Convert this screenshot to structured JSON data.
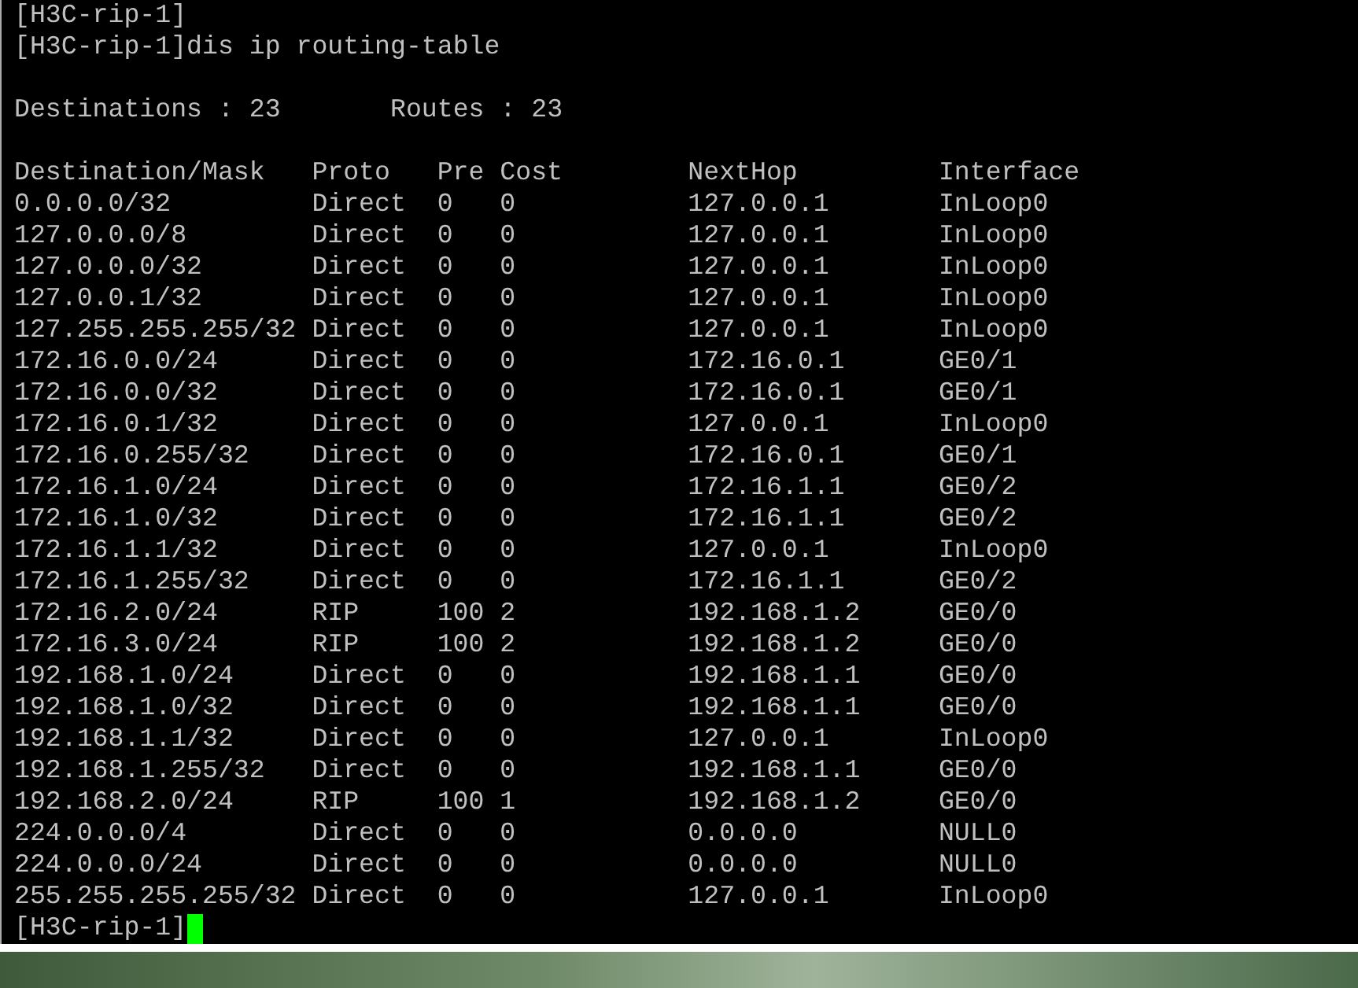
{
  "terminal": {
    "lines_before": [
      "[H3C-rip-1]",
      "[H3C-rip-1]dis ip routing-table"
    ],
    "summary": {
      "destinations": "Destinations : 23",
      "routes": "Routes : 23"
    },
    "table": {
      "columns": [
        "Destination/Mask",
        "Proto",
        "Pre",
        "Cost",
        "NextHop",
        "Interface"
      ],
      "rows": [
        [
          "0.0.0.0/32",
          "Direct",
          "0",
          "0",
          "127.0.0.1",
          "InLoop0"
        ],
        [
          "127.0.0.0/8",
          "Direct",
          "0",
          "0",
          "127.0.0.1",
          "InLoop0"
        ],
        [
          "127.0.0.0/32",
          "Direct",
          "0",
          "0",
          "127.0.0.1",
          "InLoop0"
        ],
        [
          "127.0.0.1/32",
          "Direct",
          "0",
          "0",
          "127.0.0.1",
          "InLoop0"
        ],
        [
          "127.255.255.255/32",
          "Direct",
          "0",
          "0",
          "127.0.0.1",
          "InLoop0"
        ],
        [
          "172.16.0.0/24",
          "Direct",
          "0",
          "0",
          "172.16.0.1",
          "GE0/1"
        ],
        [
          "172.16.0.0/32",
          "Direct",
          "0",
          "0",
          "172.16.0.1",
          "GE0/1"
        ],
        [
          "172.16.0.1/32",
          "Direct",
          "0",
          "0",
          "127.0.0.1",
          "InLoop0"
        ],
        [
          "172.16.0.255/32",
          "Direct",
          "0",
          "0",
          "172.16.0.1",
          "GE0/1"
        ],
        [
          "172.16.1.0/24",
          "Direct",
          "0",
          "0",
          "172.16.1.1",
          "GE0/2"
        ],
        [
          "172.16.1.0/32",
          "Direct",
          "0",
          "0",
          "172.16.1.1",
          "GE0/2"
        ],
        [
          "172.16.1.1/32",
          "Direct",
          "0",
          "0",
          "127.0.0.1",
          "InLoop0"
        ],
        [
          "172.16.1.255/32",
          "Direct",
          "0",
          "0",
          "172.16.1.1",
          "GE0/2"
        ],
        [
          "172.16.2.0/24",
          "RIP",
          "100",
          "2",
          "192.168.1.2",
          "GE0/0"
        ],
        [
          "172.16.3.0/24",
          "RIP",
          "100",
          "2",
          "192.168.1.2",
          "GE0/0"
        ],
        [
          "192.168.1.0/24",
          "Direct",
          "0",
          "0",
          "192.168.1.1",
          "GE0/0"
        ],
        [
          "192.168.1.0/32",
          "Direct",
          "0",
          "0",
          "192.168.1.1",
          "GE0/0"
        ],
        [
          "192.168.1.1/32",
          "Direct",
          "0",
          "0",
          "127.0.0.1",
          "InLoop0"
        ],
        [
          "192.168.1.255/32",
          "Direct",
          "0",
          "0",
          "192.168.1.1",
          "GE0/0"
        ],
        [
          "192.168.2.0/24",
          "RIP",
          "100",
          "1",
          "192.168.1.2",
          "GE0/0"
        ],
        [
          "224.0.0.0/4",
          "Direct",
          "0",
          "0",
          "0.0.0.0",
          "NULL0"
        ],
        [
          "224.0.0.0/24",
          "Direct",
          "0",
          "0",
          "0.0.0.0",
          "NULL0"
        ],
        [
          "255.255.255.255/32",
          "Direct",
          "0",
          "0",
          "127.0.0.1",
          "InLoop0"
        ]
      ]
    },
    "prompt": "[H3C-rip-1]"
  }
}
